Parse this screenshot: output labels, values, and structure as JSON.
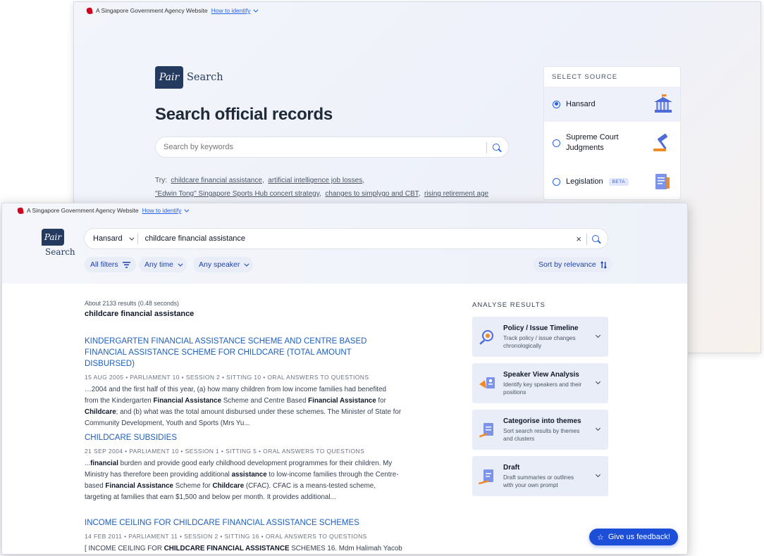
{
  "gov_banner": {
    "text": "A Singapore Government Agency Website",
    "link": "How to identify"
  },
  "logo": {
    "badge": "Pair",
    "name": "Search"
  },
  "home": {
    "heading": "Search official records",
    "search_placeholder": "Search by keywords",
    "try_label": "Try:",
    "suggestions": [
      "childcare financial assistance",
      "artificial intelligence job losses",
      "\"Edwin Tong\" Singapore Sports Hub concert strategy",
      "changes to simplygo and CBT",
      "rising retirement age"
    ]
  },
  "source_panel": {
    "heading": "SELECT SOURCE",
    "options": [
      {
        "label": "Hansard",
        "selected": true,
        "icon": "parliament-icon"
      },
      {
        "label": "Supreme Court Judgments",
        "selected": false,
        "icon": "gavel-icon"
      },
      {
        "label": "Legislation",
        "badge": "BETA",
        "selected": false,
        "icon": "document-icon"
      }
    ]
  },
  "results_page": {
    "source_selected": "Hansard",
    "query": "childcare financial assistance",
    "filters": {
      "all": "All filters",
      "time": "Any time",
      "speaker": "Any speaker",
      "sort": "Sort by relevance"
    },
    "summary": "About 2133 results (0.48 seconds)",
    "query_heading": "childcare financial assistance",
    "results": [
      {
        "title": "KINDERGARTEN FINANCIAL ASSISTANCE SCHEME AND CENTRE BASED FINANCIAL ASSISTANCE SCHEME FOR CHILDCARE (TOTAL AMOUNT DISBURSED)",
        "meta": "15 AUG 2005 • PARLIAMENT 10 • SESSION 2 • SITTING 10 • ORAL ANSWERS TO QUESTIONS"
      },
      {
        "title": "CHILDCARE SUBSIDIES",
        "meta": "21 SEP 2004 • PARLIAMENT 10 • SESSION 1 • SITTING 5 • ORAL ANSWERS TO QUESTIONS"
      },
      {
        "title": "INCOME CEILING FOR CHILDCARE FINANCIAL ASSISTANCE SCHEMES",
        "meta": "14 FEB 2011 • PARLIAMENT 11 • SESSION 2 • SITTING 16 • ORAL ANSWERS TO QUESTIONS"
      }
    ]
  },
  "analyse": {
    "heading": "ANALYSE RESULTS",
    "cards": [
      {
        "title": "Policy / Issue Timeline",
        "desc_1": "Track policy / issue changes",
        "desc_2": "chronologically"
      },
      {
        "title": "Speaker View Analysis",
        "desc_1": "Identify key speakers and their",
        "desc_2": "positions"
      },
      {
        "title": "Categorise into themes",
        "desc_1": "Sort search results by themes",
        "desc_2": "and clusters"
      },
      {
        "title": "Draft",
        "desc_1": "Draft summaries or outlines",
        "desc_2": "with your own prompt"
      }
    ]
  },
  "feedback": {
    "label": "Give us feedback!",
    "icon": "star-icon"
  },
  "colors": {
    "primary": "#2563eb",
    "brand_navy": "#243a5e",
    "chip_bg": "#e8edf8",
    "link_title": "#1d5fbf"
  }
}
